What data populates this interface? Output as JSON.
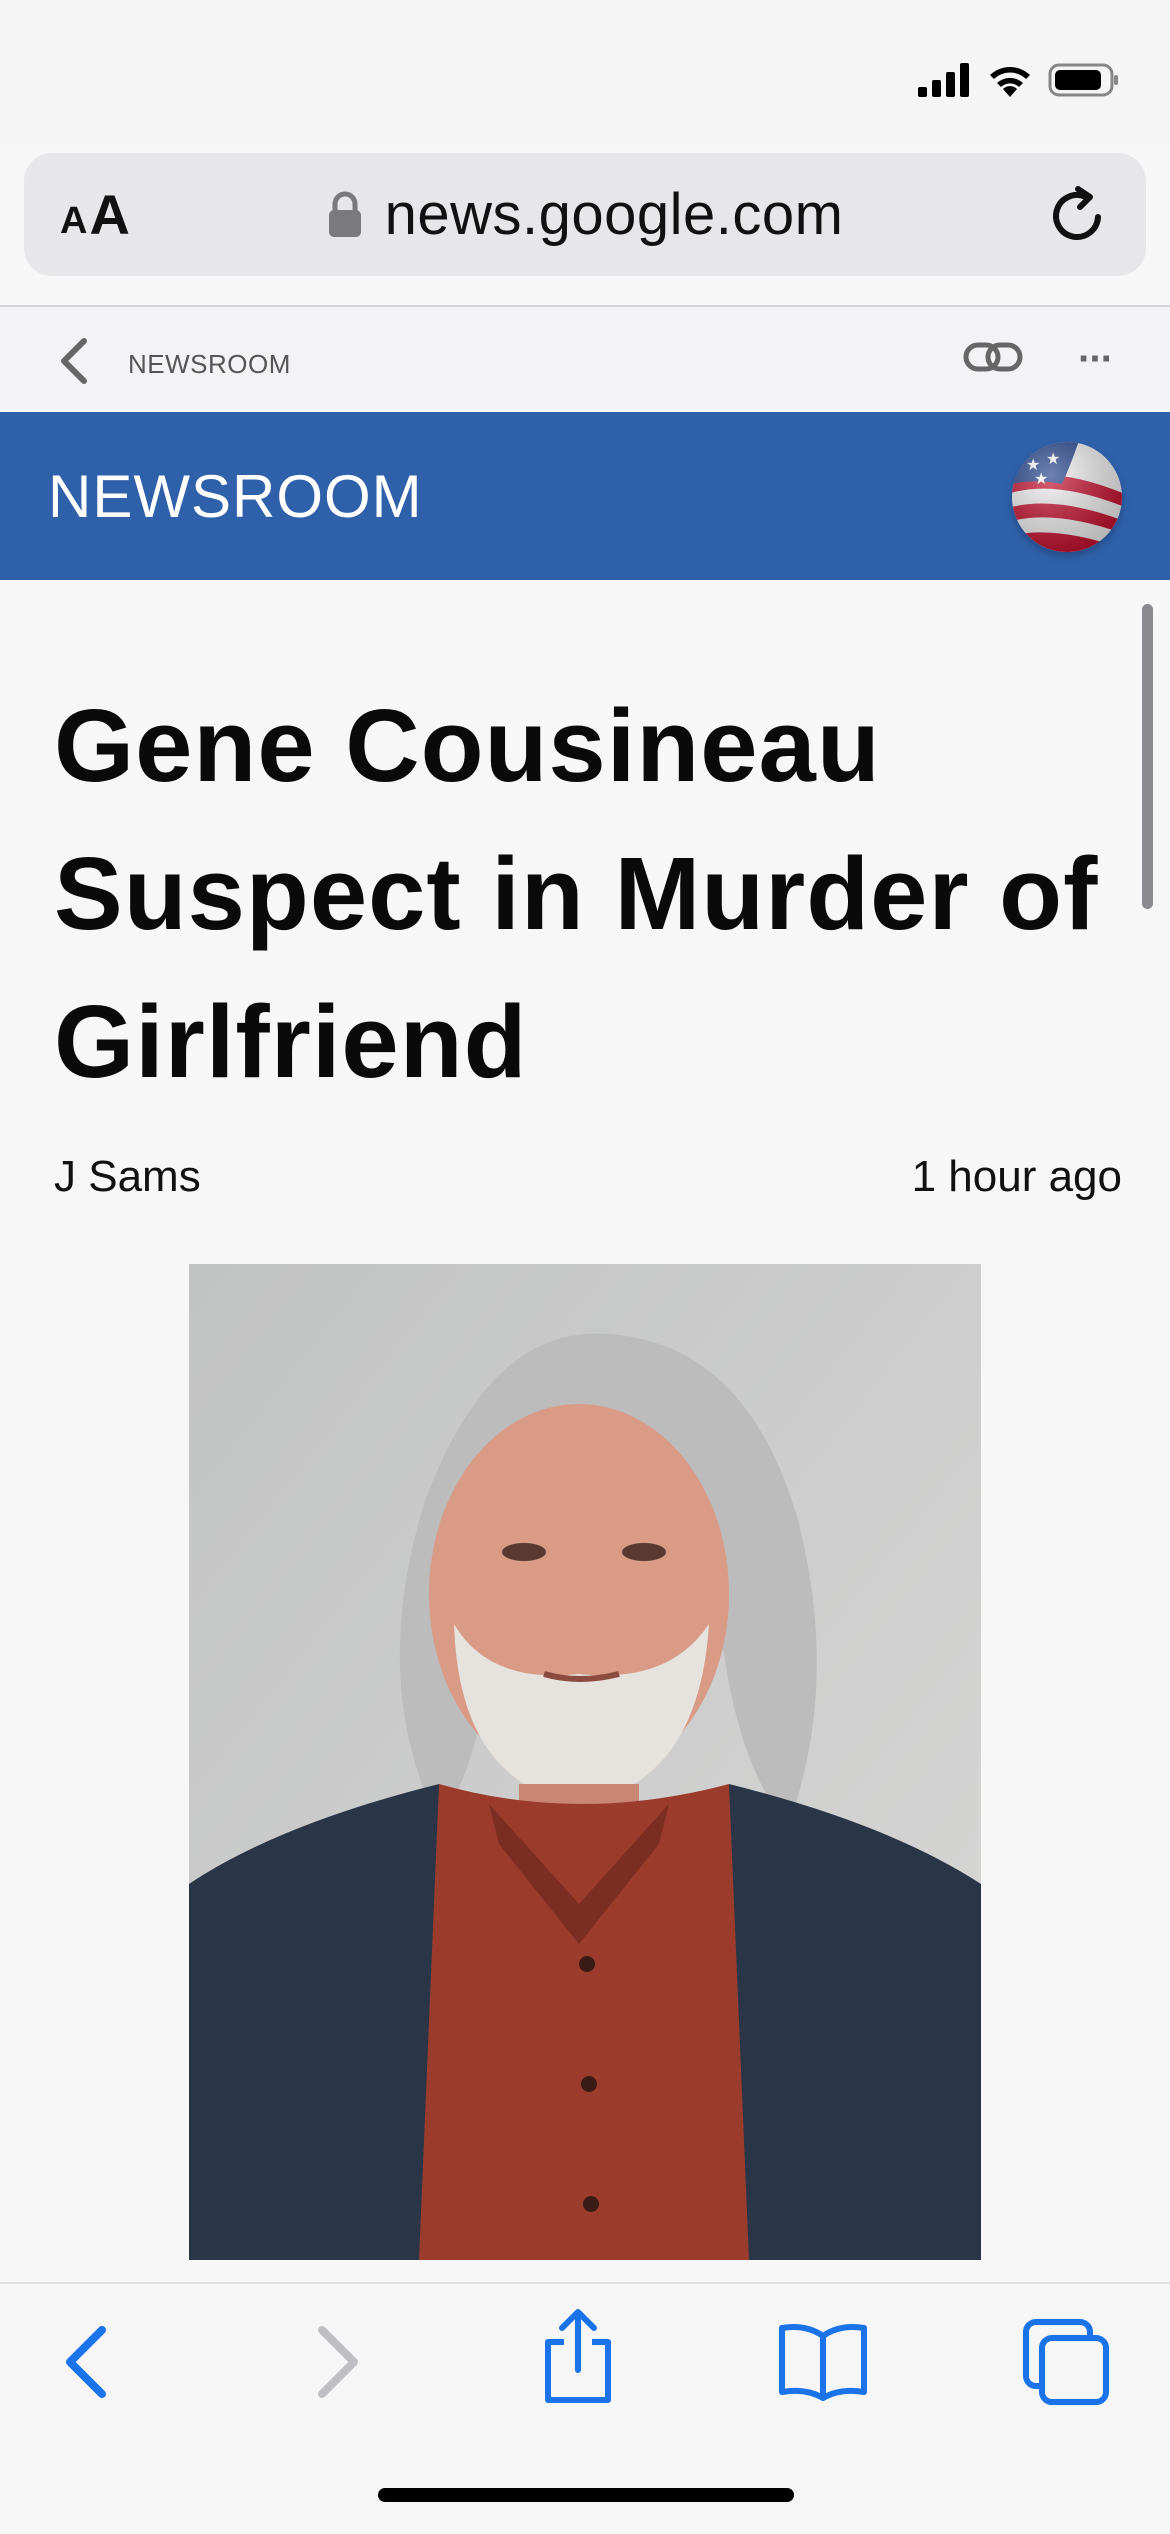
{
  "browser": {
    "text_size_small": "A",
    "text_size_large": "A",
    "url": "news.google.com"
  },
  "nav_strip": {
    "label": "NEWSROOM"
  },
  "masthead": {
    "title": "NEWSROOM"
  },
  "article": {
    "headline": "Gene Cousineau Suspect in Murder of Girlfriend",
    "author": "J Sams",
    "time": "1 hour ago"
  },
  "colors": {
    "masthead_bg": "#2f61ab",
    "toolbar_accent": "#1a73e8"
  },
  "icons": [
    "signal-icon",
    "wifi-icon",
    "battery-icon",
    "lock-icon",
    "reload-icon",
    "back-icon",
    "link-icon",
    "more-icon",
    "flag-icon",
    "share-icon",
    "bookmarks-icon",
    "tabs-icon"
  ]
}
